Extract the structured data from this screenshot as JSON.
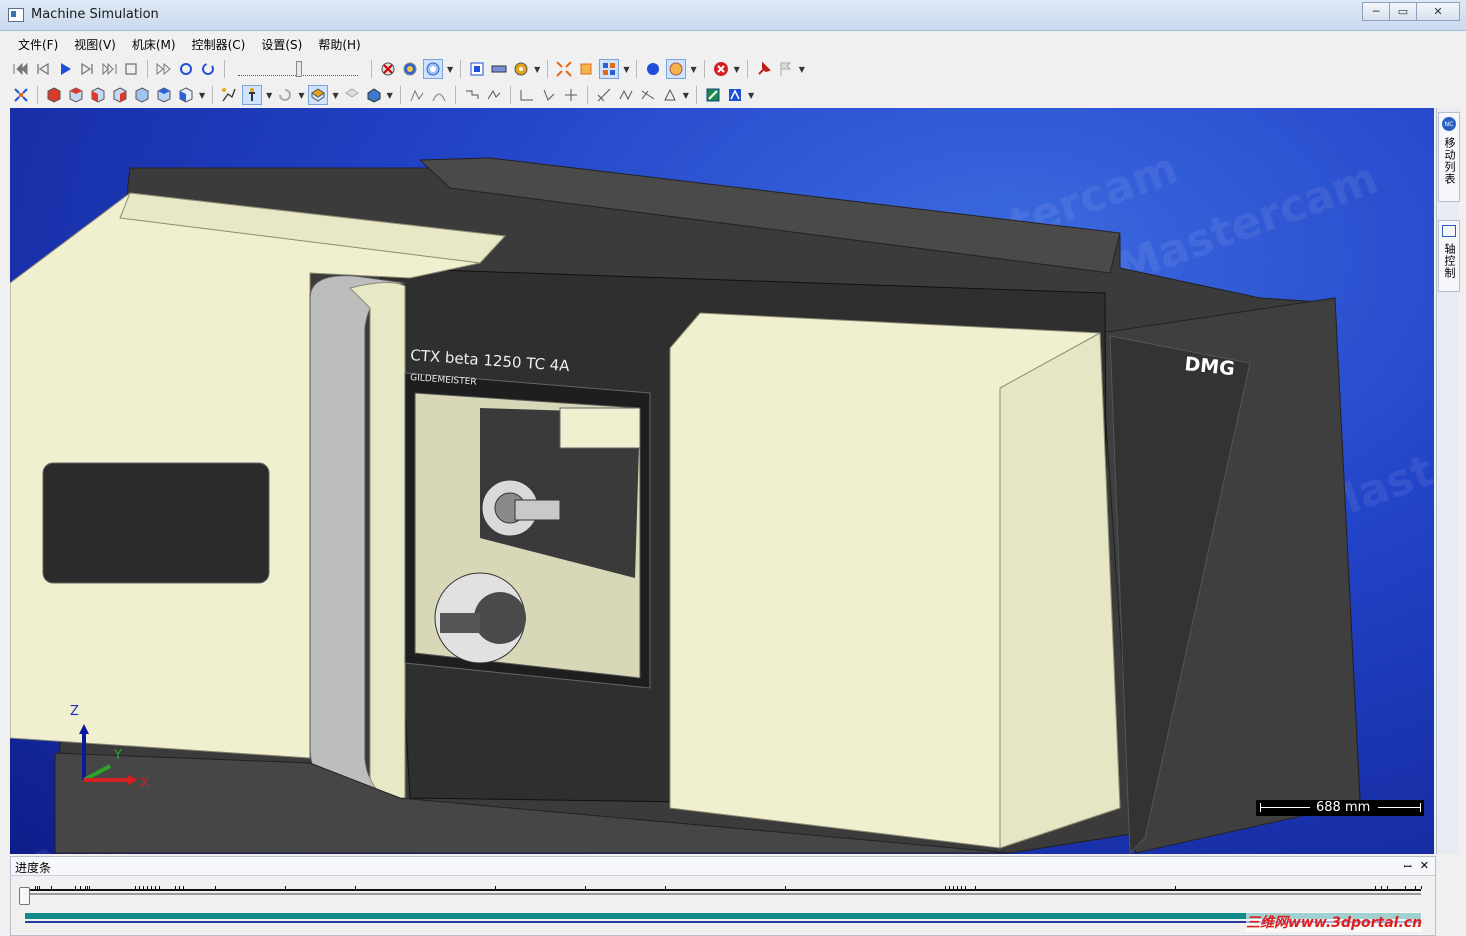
{
  "window": {
    "title": "Machine Simulation",
    "min": "─",
    "max": "▭",
    "close": "✕"
  },
  "menu": [
    {
      "label": "文件(F)"
    },
    {
      "label": "视图(V)"
    },
    {
      "label": "机床(M)"
    },
    {
      "label": "控制器(C)"
    },
    {
      "label": "设置(S)"
    },
    {
      "label": "帮助(H)"
    }
  ],
  "toolbar1": {
    "icons": [
      "skip-first-icon",
      "step-back-icon",
      "play-icon",
      "step-forward-icon",
      "skip-last-icon",
      "stop-icon",
      "fast-forward-icon",
      "loop-icon",
      "refresh-icon",
      "collision-icon",
      "view-sphere-icon",
      "view-target-icon",
      "workpiece-icon",
      "material-icon",
      "settings-gear-icon",
      "fit-icon",
      "fit-all-icon",
      "grid-view-icon",
      "globe-icon",
      "axis-icon",
      "error-icon",
      "pin-icon",
      "flag-icon"
    ]
  },
  "toolbar2": {
    "icons": [
      "zoom-fit-icon",
      "cube-red-icon",
      "cube-red2-icon",
      "cube-red3-icon",
      "cube-blue-icon",
      "cube-blue2-icon",
      "cube-blue3-icon",
      "cube-blue4-icon",
      "tool-path-icon",
      "tool-icon",
      "rotate-icon",
      "shaded-view-icon",
      "wire-view-icon",
      "stock-view-icon",
      "curve-icon",
      "curve2-icon",
      "path-icon",
      "path2-icon",
      "path3-icon",
      "path4-icon",
      "path5-icon",
      "path6-icon",
      "path7-icon",
      "path8-icon",
      "path9-icon",
      "export-icon",
      "report-icon"
    ]
  },
  "side_tabs": [
    {
      "label": "移动列表",
      "badge": "NC"
    },
    {
      "label": "轴控制"
    }
  ],
  "viewport": {
    "machine_model": "CTX beta 1250 TC 4A",
    "machine_brand": "GILDEMEISTER",
    "machine_logo": "DMG",
    "watermark": "Mastercam",
    "axis_z": "Z",
    "axis_y": "Y",
    "axis_x": "X",
    "scale_label": "688 mm",
    "colors": {
      "body": "#f0efcf",
      "dark": "#3a3a3a",
      "blue": "#2244c8"
    }
  },
  "progress_panel": {
    "title": "进度条",
    "pin": "📌",
    "close": "✕",
    "progress": 1.0
  },
  "corner_watermark": "三维网www.3dportal.cn"
}
